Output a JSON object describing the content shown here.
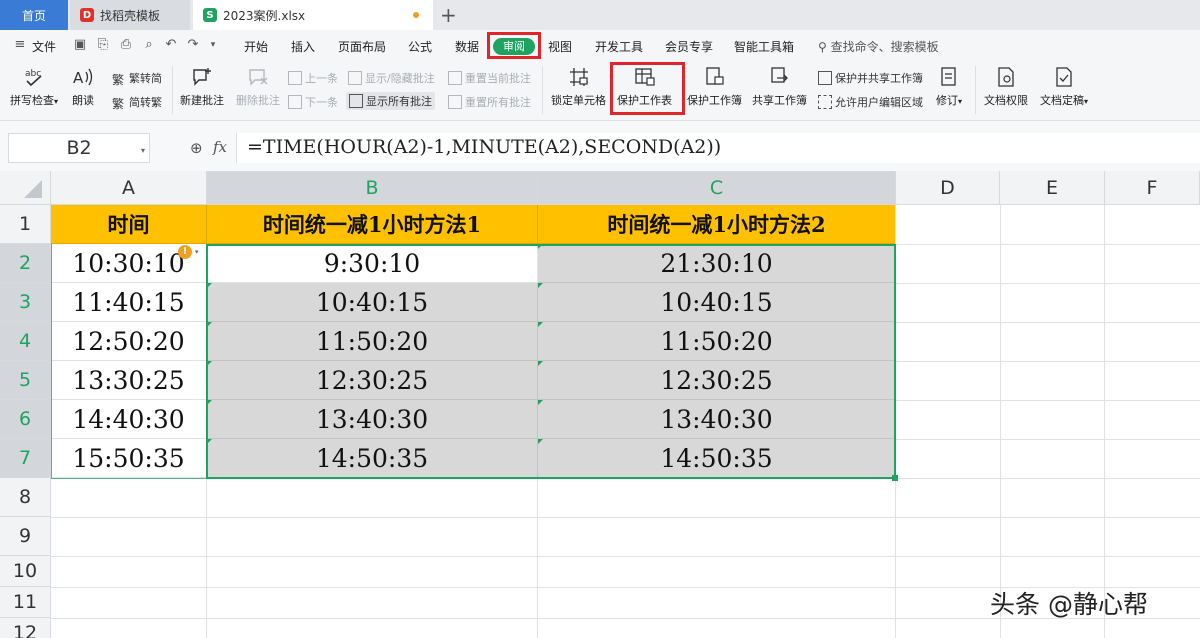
{
  "tabs": {
    "home": "首页",
    "template": "找稻壳模板",
    "file": "2023案例.xlsx",
    "new_tab": "+"
  },
  "menu": {
    "file": "文件",
    "items": [
      "开始",
      "插入",
      "页面布局",
      "公式",
      "数据",
      "审阅",
      "视图",
      "开发工具",
      "会员专享",
      "智能工具箱"
    ],
    "search": "查找命令、搜索模板"
  },
  "ribbon": {
    "spellcheck": "拼写检查",
    "read_aloud": "朗读",
    "to_traditional": "繁转简",
    "to_simplified": "简转繁",
    "new_comment": "新建批注",
    "delete_comment": "删除批注",
    "prev": "上一条",
    "next": "下一条",
    "show_hide_comment": "显示/隐藏批注",
    "show_all_comments": "显示所有批注",
    "reset_current_comment": "重置当前批注",
    "reset_all_comments": "重置所有批注",
    "lock_cells": "锁定单元格",
    "protect_sheet": "保护工作表",
    "protect_workbook": "保护工作簿",
    "share_workbook": "共享工作簿",
    "protect_and_share": "保护并共享工作簿",
    "allow_edit_ranges": "允许用户编辑区域",
    "track_changes": "修订",
    "doc_permission": "文档权限",
    "doc_finalize": "文档定稿"
  },
  "formula_bar": {
    "cell_ref": "B2",
    "fx": "fx",
    "formula": "=TIME(HOUR(A2)-1,MINUTE(A2),SECOND(A2))"
  },
  "columns": [
    "A",
    "B",
    "C",
    "D",
    "E",
    "F"
  ],
  "rows": [
    "1",
    "2",
    "3",
    "4",
    "5",
    "6",
    "7",
    "8",
    "9",
    "10",
    "11",
    "12"
  ],
  "sheet": {
    "headers": [
      "时间",
      "时间统一减1小时方法1",
      "时间统一减1小时方法2"
    ],
    "data": [
      [
        "10:30:10",
        "9:30:10",
        "21:30:10"
      ],
      [
        "11:40:15",
        "10:40:15",
        "10:40:15"
      ],
      [
        "12:50:20",
        "11:50:20",
        "11:50:20"
      ],
      [
        "13:30:25",
        "12:30:25",
        "12:30:25"
      ],
      [
        "14:40:30",
        "13:40:30",
        "13:40:30"
      ],
      [
        "15:50:35",
        "14:50:35",
        "14:50:35"
      ]
    ]
  },
  "watermark": "头条 @静心帮",
  "colors": {
    "accent_green": "#1ea361",
    "header_fill": "#ffc000",
    "highlight_red": "#e0262b",
    "home_tab": "#3a7bd5"
  }
}
